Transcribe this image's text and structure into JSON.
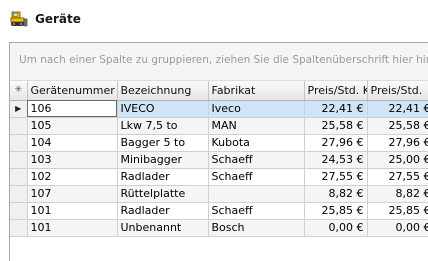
{
  "window": {
    "title": "Geräte",
    "icon": "bulldozer-icon"
  },
  "grid": {
    "group_hint": "Um nach einer Spalte zu gruppieren, ziehen Sie die Spaltenüberschrift hier hinein",
    "indicator_header": "✳",
    "selected_row_marker": "▶",
    "columns": [
      "Gerätenummer",
      "Bezeichnung",
      "Fabrikat",
      "Preis/Std. Ka",
      "Preis/Std."
    ],
    "rows": [
      {
        "nummer": "106",
        "bezeichnung": "IVECO",
        "fabrikat": "Iveco",
        "preis_ka": "22,41 €",
        "preis": "22,41 €"
      },
      {
        "nummer": "105",
        "bezeichnung": "Lkw 7,5 to",
        "fabrikat": "MAN",
        "preis_ka": "25,58 €",
        "preis": "25,58 €"
      },
      {
        "nummer": "104",
        "bezeichnung": "Bagger 5 to",
        "fabrikat": "Kubota",
        "preis_ka": "27,96 €",
        "preis": "27,96 €"
      },
      {
        "nummer": "103",
        "bezeichnung": "Minibagger",
        "fabrikat": "Schaeff",
        "preis_ka": "24,53 €",
        "preis": "25,00 €"
      },
      {
        "nummer": "102",
        "bezeichnung": "Radlader",
        "fabrikat": "Schaeff",
        "preis_ka": "27,55 €",
        "preis": "27,55 €"
      },
      {
        "nummer": "107",
        "bezeichnung": "Rüttelplatte",
        "fabrikat": "",
        "preis_ka": "8,82 €",
        "preis": "8,82 €"
      },
      {
        "nummer": "101",
        "bezeichnung": "Radlader",
        "fabrikat": "Schaeff",
        "preis_ka": "25,85 €",
        "preis": "25,85 €"
      },
      {
        "nummer": "101",
        "bezeichnung": "Unbenannt",
        "fabrikat": "Bosch",
        "preis_ka": "0,00 €",
        "preis": "0,00 €"
      }
    ]
  },
  "colors": {
    "selected_row": "#cfe4f7",
    "header_gradient_top": "#fbfbfb",
    "header_gradient_bottom": "#e6e6e6",
    "hint_text": "#9a9a9a"
  }
}
